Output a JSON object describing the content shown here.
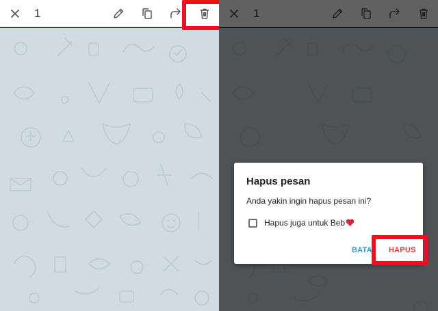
{
  "left_panel": {
    "toolbar": {
      "close_icon": "close-icon",
      "selected_count": "1",
      "actions": [
        "edit-icon",
        "copy-icon",
        "forward-icon",
        "delete-icon"
      ]
    }
  },
  "right_panel": {
    "toolbar": {
      "selected_count": "1"
    },
    "dialog": {
      "title": "Hapus pesan",
      "message": "Anda yakin ingin hapus pesan ini?",
      "checkbox_label": "Hapus juga untuk Beb",
      "checkbox_checked": false,
      "cancel_label": "BATAL",
      "delete_label": "HAPUS"
    }
  },
  "colors": {
    "highlight": "#f00f1e",
    "cancel_button": "#3a95d5",
    "delete_button": "#e53935",
    "chat_background": "#d0dbe2"
  }
}
